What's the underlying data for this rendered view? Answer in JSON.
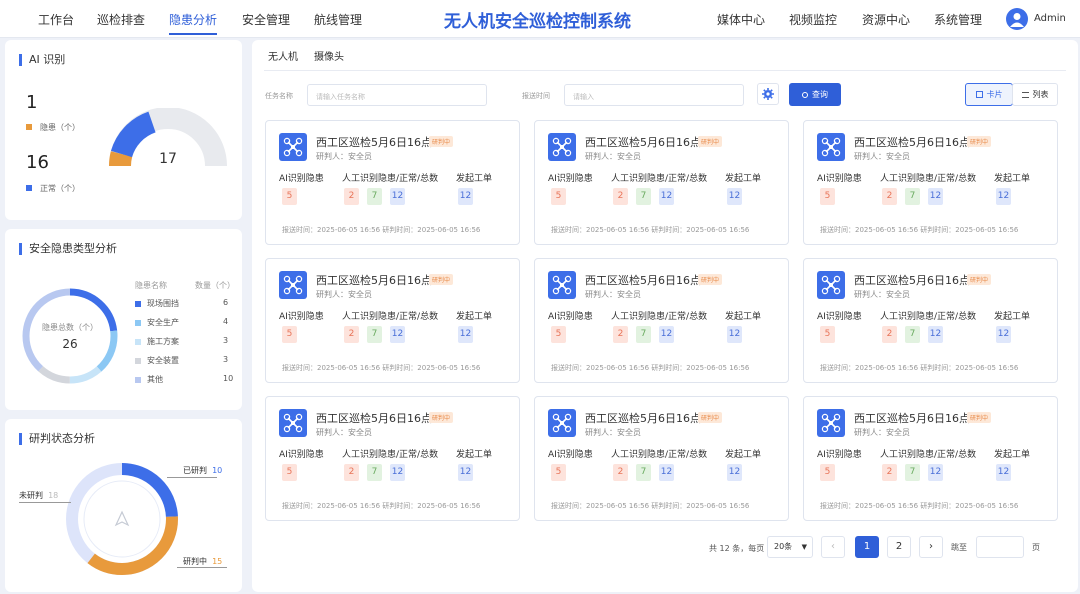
{
  "header": {
    "nav_left": [
      "工作台",
      "巡检排查",
      "隐患分析",
      "安全管理",
      "航线管理"
    ],
    "title": "无人机安全巡检控制系统",
    "nav_right": [
      "媒体中心",
      "视频监控",
      "资源中心",
      "系统管理"
    ],
    "user": "Admin"
  },
  "ai": {
    "title": "AI 识别",
    "hazard_count": "1",
    "hazard_label": "隐患（个）",
    "normal_count": "16",
    "normal_label": "正常（个）",
    "center": "17",
    "colors": {
      "hazard": "#e89a3c",
      "normal": "#3d6ee8"
    }
  },
  "types": {
    "title": "安全隐患类型分析",
    "center_label": "隐患总数（个）",
    "center_value": "26",
    "col_name": "隐患名称",
    "col_count": "数量（个）",
    "items": [
      {
        "name": "现场围挡",
        "value": "6",
        "color": "#3d6ee8"
      },
      {
        "name": "安全生产",
        "value": "4",
        "color": "#8cc8f4"
      },
      {
        "name": "施工方案",
        "value": "3",
        "color": "#c7e4f8"
      },
      {
        "name": "安全装置",
        "value": "3",
        "color": "#d3d6dc"
      },
      {
        "name": "其他",
        "value": "10",
        "color": "#b8c8f0"
      }
    ]
  },
  "status": {
    "title": "研判状态分析",
    "done_label": "已研判",
    "done_value": "10",
    "not_label": "未研判",
    "not_value": "18",
    "doing_label": "研判中",
    "doing_value": "15"
  },
  "tabs": [
    "无人机",
    "摄像头"
  ],
  "filters": {
    "task_label": "任务名称",
    "task_placeholder": "请输入任务名称",
    "time_label": "报送时间",
    "time_placeholder": "请输入",
    "search": "查询",
    "card_view": "卡片",
    "list_view": "列表"
  },
  "cards": [
    {
      "title": "西工区巡检5月6日16点",
      "badge": "研判中",
      "judge": "研判人：安全员",
      "h1": "AI识别隐患",
      "h2": "人工识别隐患/正常/总数",
      "h3": "发起工单",
      "ai": "5",
      "hazard": "2",
      "normal": "7",
      "total": "12",
      "order": "12",
      "foot": "报送时间：2025-06-05  16:56     研判时间：2025-06-05  16:56"
    },
    {
      "title": "西工区巡检5月6日16点",
      "badge": "研判中",
      "judge": "研判人：安全员",
      "h1": "AI识别隐患",
      "h2": "人工识别隐患/正常/总数",
      "h3": "发起工单",
      "ai": "5",
      "hazard": "2",
      "normal": "7",
      "total": "12",
      "order": "12",
      "foot": "报送时间：2025-06-05  16:56     研判时间：2025-06-05  16:56"
    },
    {
      "title": "西工区巡检5月6日16点",
      "badge": "研判中",
      "judge": "研判人：安全员",
      "h1": "AI识别隐患",
      "h2": "人工识别隐患/正常/总数",
      "h3": "发起工单",
      "ai": "5",
      "hazard": "2",
      "normal": "7",
      "total": "12",
      "order": "12",
      "foot": "报送时间：2025-06-05  16:56     研判时间：2025-06-05  16:56"
    },
    {
      "title": "西工区巡检5月6日16点",
      "badge": "研判中",
      "judge": "研判人：安全员",
      "h1": "AI识别隐患",
      "h2": "人工识别隐患/正常/总数",
      "h3": "发起工单",
      "ai": "5",
      "hazard": "2",
      "normal": "7",
      "total": "12",
      "order": "12",
      "foot": "报送时间：2025-06-05  16:56     研判时间：2025-06-05  16:56"
    },
    {
      "title": "西工区巡检5月6日16点",
      "badge": "研判中",
      "judge": "研判人：安全员",
      "h1": "AI识别隐患",
      "h2": "人工识别隐患/正常/总数",
      "h3": "发起工单",
      "ai": "5",
      "hazard": "2",
      "normal": "7",
      "total": "12",
      "order": "12",
      "foot": "报送时间：2025-06-05  16:56     研判时间：2025-06-05  16:56"
    },
    {
      "title": "西工区巡检5月6日16点",
      "badge": "研判中",
      "judge": "研判人：安全员",
      "h1": "AI识别隐患",
      "h2": "人工识别隐患/正常/总数",
      "h3": "发起工单",
      "ai": "5",
      "hazard": "2",
      "normal": "7",
      "total": "12",
      "order": "12",
      "foot": "报送时间：2025-06-05  16:56     研判时间：2025-06-05  16:56"
    },
    {
      "title": "西工区巡检5月6日16点",
      "badge": "研判中",
      "judge": "研判人：安全员",
      "h1": "AI识别隐患",
      "h2": "人工识别隐患/正常/总数",
      "h3": "发起工单",
      "ai": "5",
      "hazard": "2",
      "normal": "7",
      "total": "12",
      "order": "12",
      "foot": "报送时间：2025-06-05  16:56     研判时间：2025-06-05  16:56"
    },
    {
      "title": "西工区巡检5月6日16点",
      "badge": "研判中",
      "judge": "研判人：安全员",
      "h1": "AI识别隐患",
      "h2": "人工识别隐患/正常/总数",
      "h3": "发起工单",
      "ai": "5",
      "hazard": "2",
      "normal": "7",
      "total": "12",
      "order": "12",
      "foot": "报送时间：2025-06-05  16:56     研判时间：2025-06-05  16:56"
    },
    {
      "title": "西工区巡检5月6日16点",
      "badge": "研判中",
      "judge": "研判人：安全员",
      "h1": "AI识别隐患",
      "h2": "人工识别隐患/正常/总数",
      "h3": "发起工单",
      "ai": "5",
      "hazard": "2",
      "normal": "7",
      "total": "12",
      "order": "12",
      "foot": "报送时间：2025-06-05  16:56     研判时间：2025-06-05  16:56"
    }
  ],
  "pagination": {
    "total": "共 12 条，每页",
    "size": "20条",
    "page1": "1",
    "page2": "2",
    "goto": "跳至",
    "page_unit": "页"
  }
}
